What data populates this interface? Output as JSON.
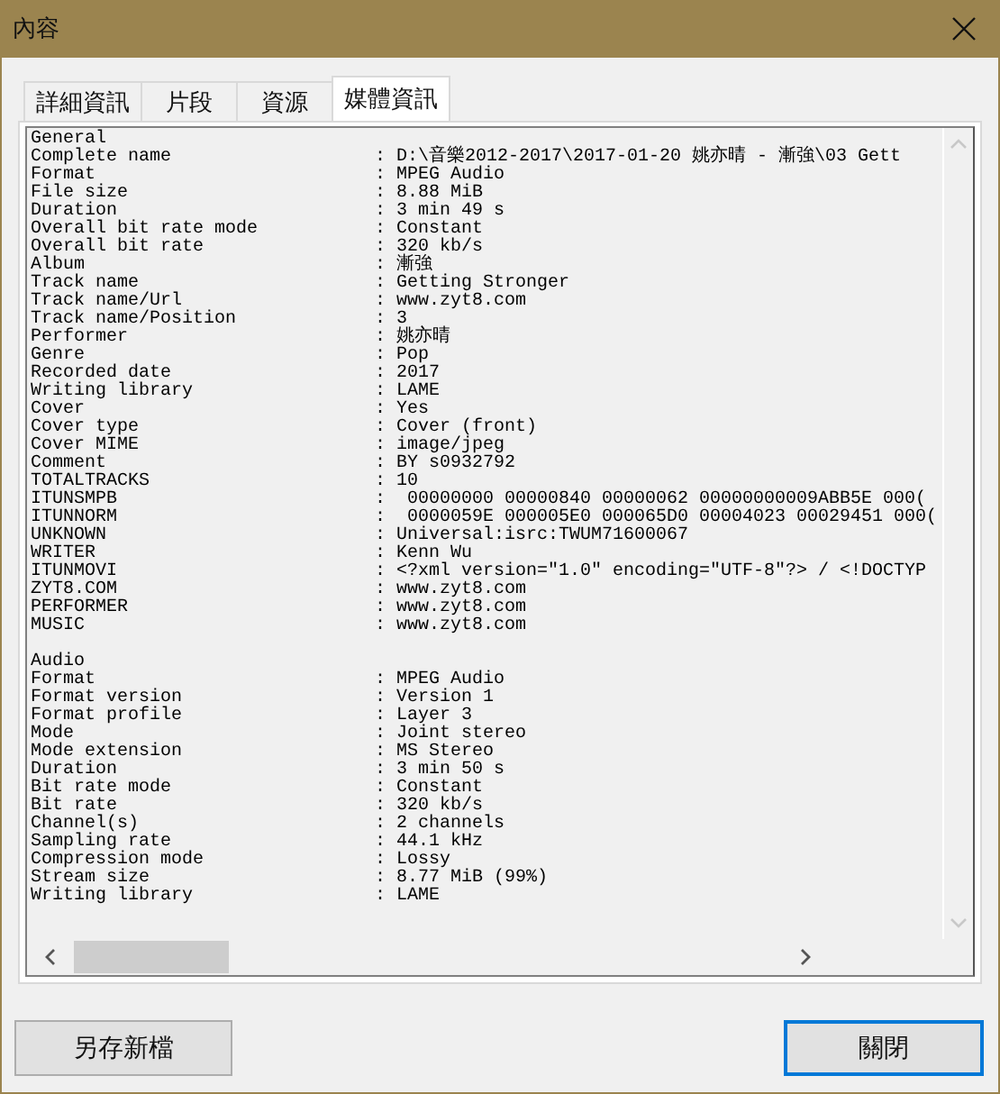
{
  "window": {
    "title": "內容"
  },
  "tabs": [
    {
      "label": "詳細資訊",
      "selected": false
    },
    {
      "label": "片段",
      "selected": false
    },
    {
      "label": "資源",
      "selected": false
    },
    {
      "label": "媒體資訊",
      "selected": true
    }
  ],
  "sections": [
    {
      "title": "General",
      "rows": [
        {
          "label": "Complete name",
          "value": ": D:\\音樂2012-2017\\2017-01-20 姚亦晴 - 漸強\\03 Gett"
        },
        {
          "label": "Format",
          "value": ": MPEG Audio"
        },
        {
          "label": "File size",
          "value": ": 8.88 MiB"
        },
        {
          "label": "Duration",
          "value": ": 3 min 49 s"
        },
        {
          "label": "Overall bit rate mode",
          "value": ": Constant"
        },
        {
          "label": "Overall bit rate",
          "value": ": 320 kb/s"
        },
        {
          "label": "Album",
          "value": ": 漸強"
        },
        {
          "label": "Track name",
          "value": ": Getting Stronger"
        },
        {
          "label": "Track name/Url",
          "value": ": www.zyt8.com"
        },
        {
          "label": "Track name/Position",
          "value": ": 3"
        },
        {
          "label": "Performer",
          "value": ": 姚亦晴"
        },
        {
          "label": "Genre",
          "value": ": Pop"
        },
        {
          "label": "Recorded date",
          "value": ": 2017"
        },
        {
          "label": "Writing library",
          "value": ": LAME"
        },
        {
          "label": "Cover",
          "value": ": Yes"
        },
        {
          "label": "Cover type",
          "value": ": Cover (front)"
        },
        {
          "label": "Cover MIME",
          "value": ": image/jpeg"
        },
        {
          "label": "Comment",
          "value": ": BY s0932792"
        },
        {
          "label": "TOTALTRACKS",
          "value": ": 10"
        },
        {
          "label": "ITUNSMPB",
          "value": ":  00000000 00000840 00000062 00000000009ABB5E 000("
        },
        {
          "label": "ITUNNORM",
          "value": ":  0000059E 000005E0 000065D0 00004023 00029451 000("
        },
        {
          "label": "UNKNOWN",
          "value": ": Universal:isrc:TWUM71600067"
        },
        {
          "label": "WRITER",
          "value": ": Kenn Wu"
        },
        {
          "label": "ITUNMOVI",
          "value": ": <?xml version=\"1.0\" encoding=\"UTF-8\"?> / <!DOCTYP"
        },
        {
          "label": "ZYT8.COM",
          "value": ": www.zyt8.com"
        },
        {
          "label": "PERFORMER",
          "value": ": www.zyt8.com"
        },
        {
          "label": "MUSIC",
          "value": ": www.zyt8.com"
        }
      ]
    },
    {
      "title": "Audio",
      "rows": [
        {
          "label": "Format",
          "value": ": MPEG Audio"
        },
        {
          "label": "Format version",
          "value": ": Version 1"
        },
        {
          "label": "Format profile",
          "value": ": Layer 3"
        },
        {
          "label": "Mode",
          "value": ": Joint stereo"
        },
        {
          "label": "Mode extension",
          "value": ": MS Stereo"
        },
        {
          "label": "Duration",
          "value": ": 3 min 50 s"
        },
        {
          "label": "Bit rate mode",
          "value": ": Constant"
        },
        {
          "label": "Bit rate",
          "value": ": 320 kb/s"
        },
        {
          "label": "Channel(s)",
          "value": ": 2 channels"
        },
        {
          "label": "Sampling rate",
          "value": ": 44.1 kHz"
        },
        {
          "label": "Compression mode",
          "value": ": Lossy"
        },
        {
          "label": "Stream size",
          "value": ": 8.77 MiB (99%)"
        },
        {
          "label": "Writing library",
          "value": ": LAME"
        }
      ]
    }
  ],
  "buttons": [
    {
      "label": "另存新檔",
      "kind": "secondary"
    },
    {
      "label": "關閉",
      "kind": "default"
    }
  ]
}
